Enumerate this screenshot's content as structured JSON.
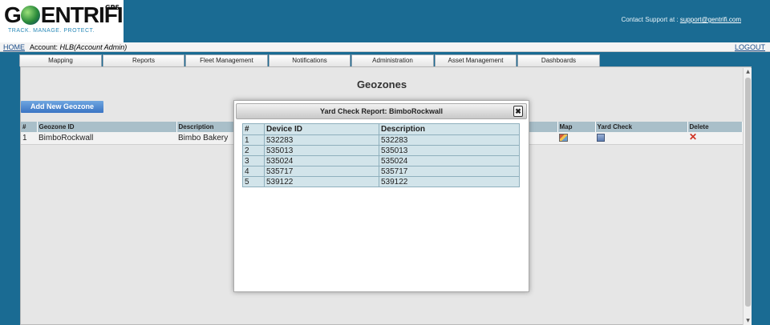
{
  "header": {
    "logo": {
      "word": "ENTRIFI",
      "initial": "G",
      "gps": "GPS",
      "tagline": "TRACK. MANAGE. PROTECT."
    },
    "contact_label": "Contact Support at :",
    "contact_email": "support@gentrifi.com"
  },
  "account_bar": {
    "home": "HOME",
    "account_label": "Account:",
    "account_value": "HLB(Account Admin)",
    "logout": "LOGOUT"
  },
  "tabs": [
    "Mapping",
    "Reports",
    "Fleet Management",
    "Notifications",
    "Administration",
    "Asset Management",
    "Dashboards"
  ],
  "page": {
    "title": "Geozones",
    "add_button": "Add New Geozone",
    "columns": {
      "num": "#",
      "geozone_id": "Geozone ID",
      "description": "Description",
      "map": "Map",
      "yard_check": "Yard Check",
      "delete": "Delete"
    },
    "rows": [
      {
        "num": "1",
        "geozone_id": "BimboRockwall",
        "description": "Bimbo Bakery"
      }
    ]
  },
  "modal": {
    "title": "Yard Check Report: BimboRockwall",
    "close": "✖",
    "columns": {
      "num": "#",
      "device_id": "Device ID",
      "description": "Description"
    },
    "rows": [
      {
        "num": "1",
        "device_id": "532283",
        "description": "532283"
      },
      {
        "num": "2",
        "device_id": "535013",
        "description": "535013"
      },
      {
        "num": "3",
        "device_id": "535024",
        "description": "535024"
      },
      {
        "num": "4",
        "device_id": "535717",
        "description": "535717"
      },
      {
        "num": "5",
        "device_id": "539122",
        "description": "539122"
      }
    ]
  },
  "colors": {
    "brand": "#1a6b93",
    "table_header": "#a9bfc9",
    "modal_cell": "#d2e4ea",
    "button": "#3a74c4"
  },
  "icons": {
    "map": "map-icon",
    "yard_check": "yard-check-icon",
    "delete": "delete-x-icon",
    "close": "close-icon"
  }
}
